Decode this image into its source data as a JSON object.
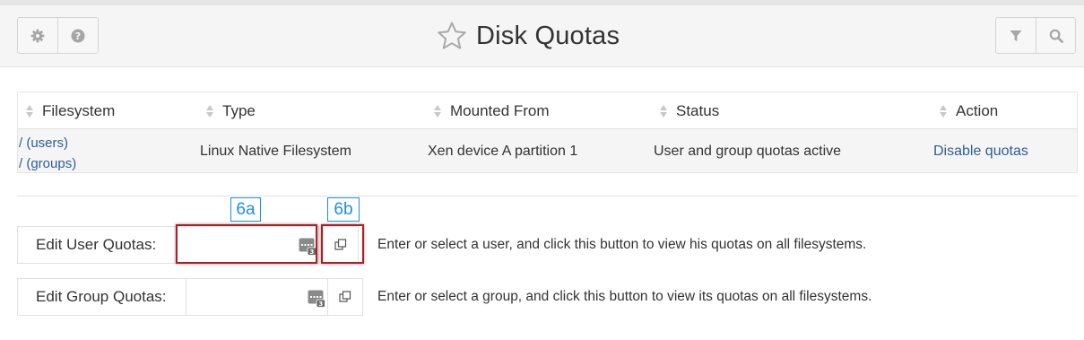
{
  "header": {
    "title": "Disk Quotas",
    "icons": {
      "settings": "gear-icon",
      "help": "question-circle-icon",
      "favorite": "star-icon",
      "filter": "filter-icon",
      "search": "search-icon"
    }
  },
  "table": {
    "columns": [
      "Filesystem",
      "Type",
      "Mounted From",
      "Status",
      "Action"
    ],
    "rows": [
      {
        "filesystem_links": [
          "/ (users)",
          "/ (groups)"
        ],
        "type": "Linux Native Filesystem",
        "mounted_from": "Xen device A partition 1",
        "status": "User and group quotas active",
        "action": "Disable quotas"
      }
    ]
  },
  "forms": {
    "user": {
      "label": "Edit User Quotas:",
      "value": "",
      "help": "Enter or select a user, and click this button to view his quotas on all filesystems."
    },
    "group": {
      "label": "Edit Group Quotas:",
      "value": "",
      "help": "Enter or select a group, and click this button to view its quotas on all filesystems."
    }
  },
  "annotations": {
    "a": "6a",
    "b": "6b"
  },
  "colors": {
    "link": "#2d5e96",
    "highlight": "#b01e23",
    "annotation": "#1b8fe3"
  }
}
